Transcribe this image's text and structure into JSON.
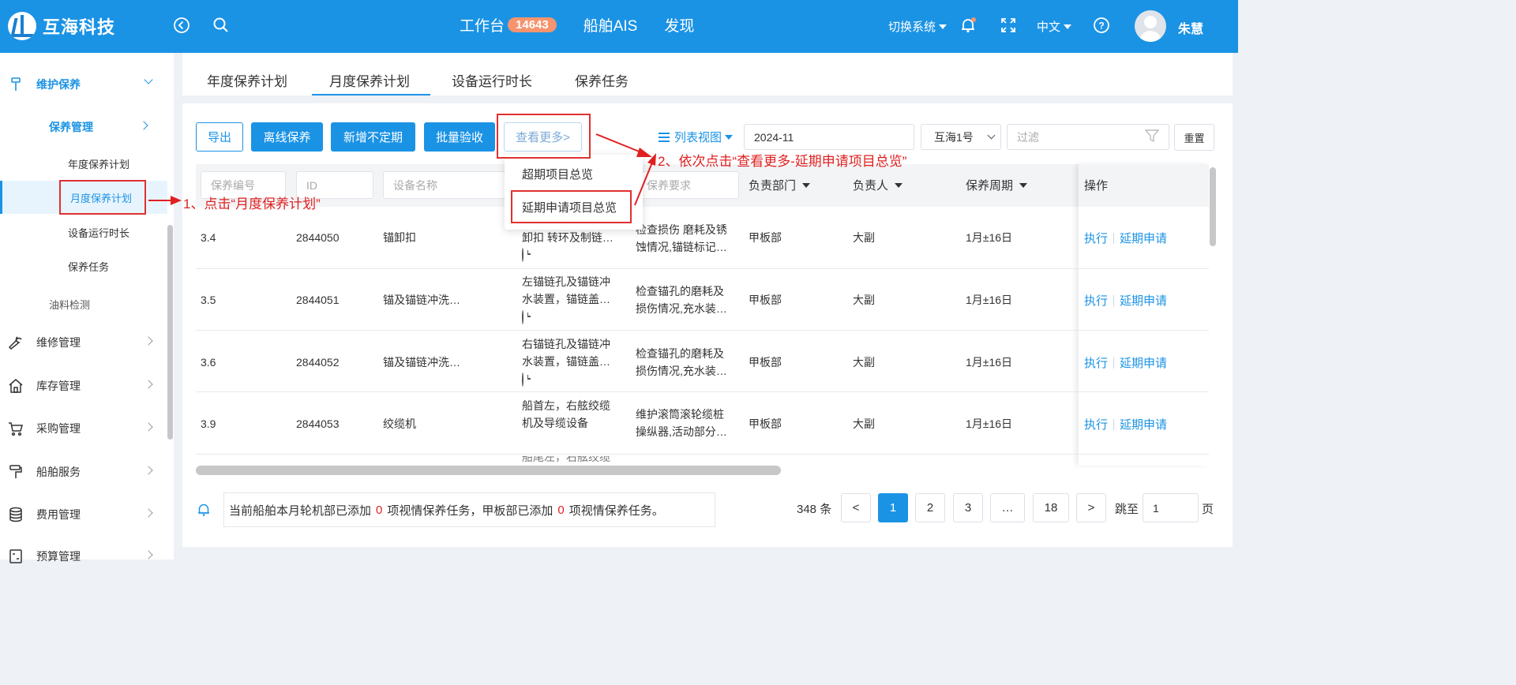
{
  "header": {
    "brand": "互海科技",
    "nav": [
      {
        "label": "工作台",
        "badge": "14643"
      },
      {
        "label": "船舶AIS"
      },
      {
        "label": "发现"
      }
    ],
    "switch_system": "切换系统",
    "language": "中文",
    "user_name": "朱慧"
  },
  "sidebar": {
    "group_active": "维护保养",
    "sub_group": "保养管理",
    "sub_items": [
      "年度保养计划",
      "月度保养计划",
      "设备运行时长",
      "保养任务"
    ],
    "oil_check": "油料检测",
    "groups": [
      "维修管理",
      "库存管理",
      "采购管理",
      "船舶服务",
      "费用管理",
      "预算管理"
    ]
  },
  "tabs": [
    "年度保养计划",
    "月度保养计划",
    "设备运行时长",
    "保养任务"
  ],
  "toolbar": {
    "export": "导出",
    "offline": "离线保养",
    "add_irregular": "新增不定期",
    "batch_accept": "批量验收",
    "more": "查看更多>",
    "list_view": "列表视图",
    "month_value": "2024-11",
    "ship_value": "互海1号",
    "filter_placeholder": "过滤",
    "reset": "重置"
  },
  "dropdown": {
    "items": [
      "超期项目总览",
      "延期申请项目总览"
    ]
  },
  "table": {
    "filter_placeholders": {
      "code": "保养编号",
      "id": "ID",
      "device": "设备名称",
      "requirement": "保养要求"
    },
    "headers": {
      "dept": "负责部门",
      "person": "负责人",
      "cycle": "保养周期",
      "ops": "操作"
    },
    "rows": [
      {
        "code": "3.4",
        "id": "2844050",
        "device": "锚卸扣",
        "content": "卸扣 转环及制链…",
        "content2": "",
        "req": "检查损伤 磨耗及锈",
        "req2": "蚀情况,锚链标记…",
        "dept": "甲板部",
        "person": "大副",
        "cycle": "1月±16日"
      },
      {
        "code": "3.5",
        "id": "2844051",
        "device": "锚及锚链冲洗…",
        "content": "左锚链孔及锚链冲",
        "content2": "水装置，锚链盖…",
        "req": "检查锚孔的磨耗及",
        "req2": "损伤情况,充水装…",
        "dept": "甲板部",
        "person": "大副",
        "cycle": "1月±16日"
      },
      {
        "code": "3.6",
        "id": "2844052",
        "device": "锚及锚链冲洗…",
        "content": "右锚链孔及锚链冲",
        "content2": "水装置，锚链盖…",
        "req": "检查锚孔的磨耗及",
        "req2": "损伤情况,充水装…",
        "dept": "甲板部",
        "person": "大副",
        "cycle": "1月±16日"
      },
      {
        "code": "3.9",
        "id": "2844053",
        "device": "绞缆机",
        "content": "船首左，右舷绞缆",
        "content2": "机及导缆设备",
        "req": "维护滚筒滚轮缆桩",
        "req2": "操纵器,活动部分…",
        "dept": "甲板部",
        "person": "大副",
        "cycle": "1月±16日"
      }
    ],
    "partial_row_text": "船尾左，右舷绞缆",
    "op_execute": "执行",
    "op_delay": "延期申请"
  },
  "annotations": {
    "step1": "1、点击“月度保养计划”",
    "step2": "2、依次点击“查看更多-延期申请项目总览”"
  },
  "footer": {
    "notice_prefix": "当前船舶本月轮机部已添加",
    "engine_count": "0",
    "notice_mid": "项视情保养任务，甲板部已添加",
    "deck_count": "0",
    "notice_suffix": "项视情保养任务。",
    "total": "348 条",
    "prev": "<",
    "pages": [
      "1",
      "2",
      "3",
      "…",
      "18"
    ],
    "next": ">",
    "goto_label": "跳至",
    "goto_value": "1",
    "page_unit": "页"
  },
  "colors": {
    "brand": "#1b93e5",
    "annotation": "#e02020",
    "badge": "#f5946e"
  }
}
